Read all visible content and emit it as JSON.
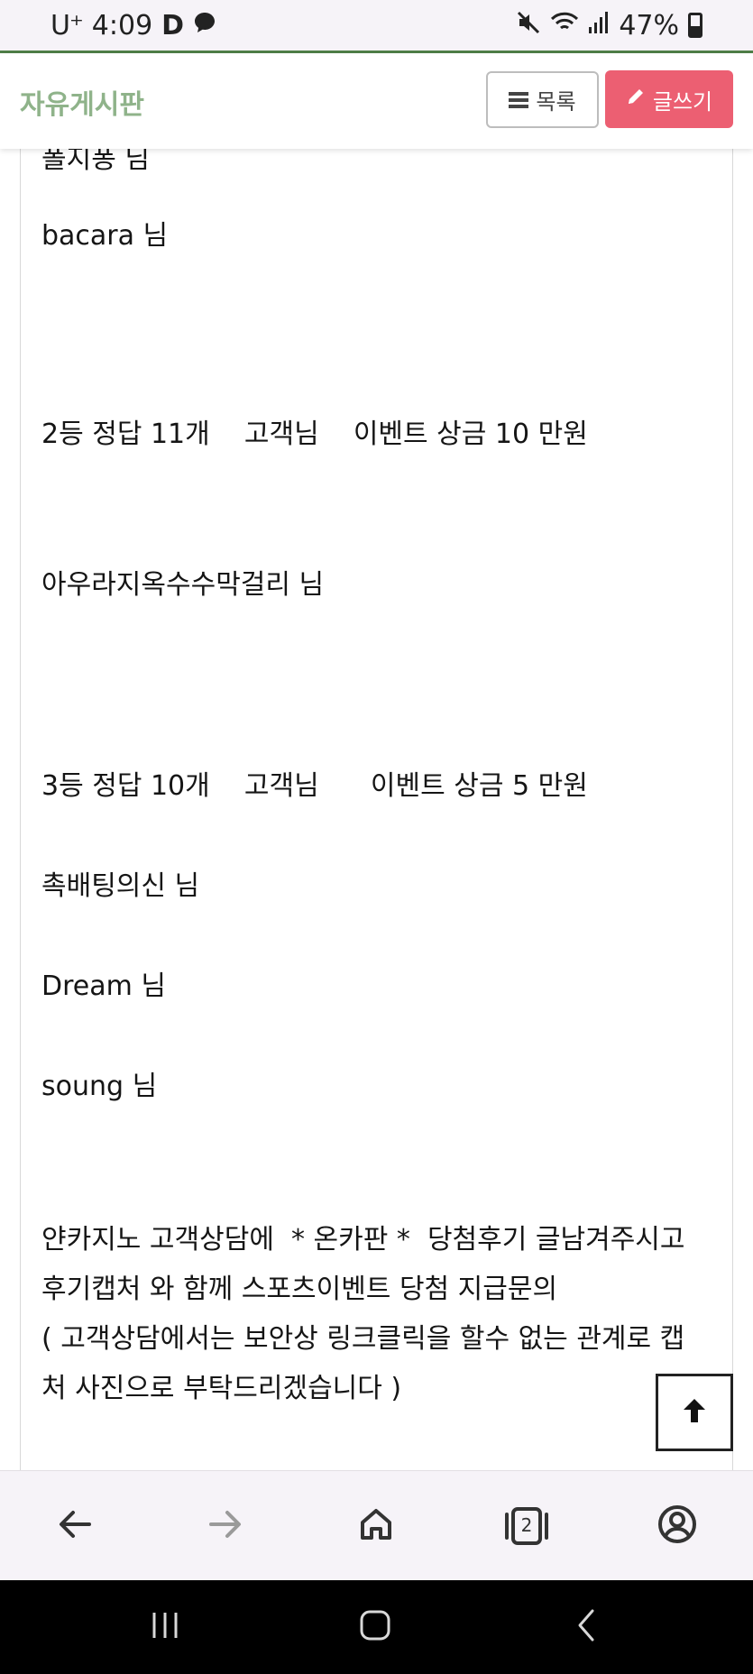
{
  "status_bar": {
    "carrier": "U⁺",
    "time": "4:09",
    "app_letter": "D",
    "battery": "47%"
  },
  "header": {
    "board_title": "자유게시판",
    "list_button": "목록",
    "write_button": "글쓰기"
  },
  "content": {
    "lines": [
      "폴지퐁 님",
      "bacara 님",
      "2등 정답 11개    고객님    이벤트 상금 10 만원",
      "아우라지옥수수막걸리 님",
      "3등 정답 10개    고객님      이벤트 상금 5 만원",
      "촉배팅의신 님",
      "Dream 님",
      "soung 님",
      "얀카지노 고객상담에  * 온카판 *  당첨후기 글남겨주시고",
      "후기캡처 와 함께 스포츠이벤트 당첨 지급문의",
      "( 고객상담에서는 보안상 링크클릭을 할수 없는 관계로 캡",
      "처 사진으로 부탁드리겠습니다 )"
    ]
  },
  "browser_bar": {
    "tab_count": "2"
  },
  "icons": {
    "list": "list-icon",
    "write": "pencil-icon",
    "scroll_top": "arrow-up-icon",
    "back": "arrow-left-icon",
    "forward": "arrow-right-icon",
    "home": "home-icon",
    "tabs": "tabs-icon",
    "account": "account-icon"
  }
}
